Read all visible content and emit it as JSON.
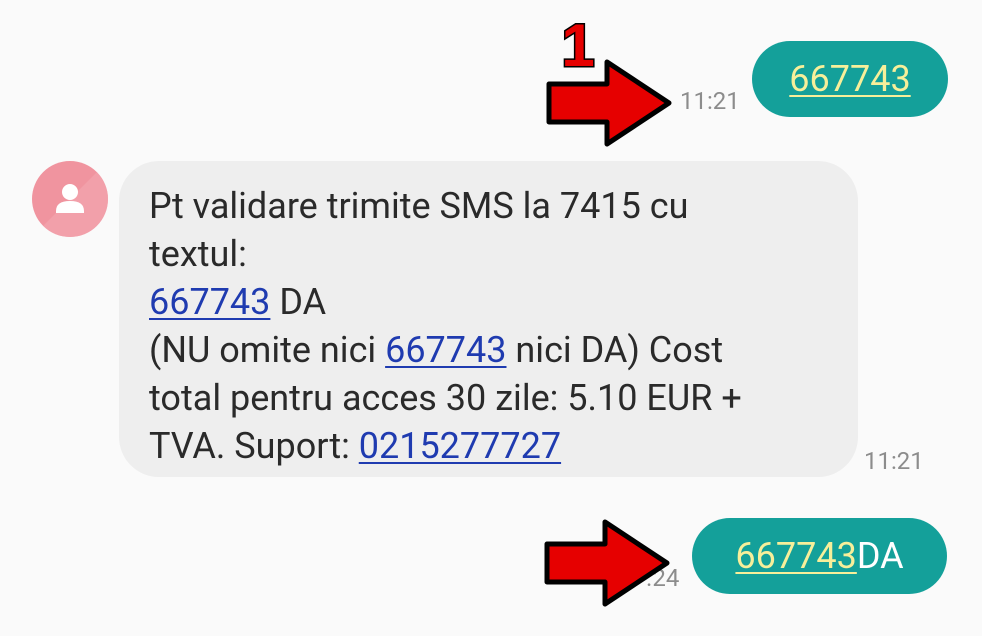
{
  "thread": {
    "messages": [
      {
        "direction": "outgoing",
        "link_text": "667743",
        "text": "",
        "time": "11:21"
      },
      {
        "direction": "incoming",
        "sender_avatar_icon": "person-icon",
        "lines": [
          {
            "before": "Pt validare trimite SMS la 7415 cu",
            "link": "",
            "after": ""
          },
          {
            "before": "textul:",
            "link": "",
            "after": ""
          },
          {
            "before": "",
            "link": "667743",
            "after": " DA"
          },
          {
            "before": "(NU omite nici ",
            "link": "667743",
            "after": " nici DA) Cost"
          },
          {
            "before": "total pentru acces 30 zile: 5.10 EUR +",
            "link": "",
            "after": ""
          },
          {
            "before": "TVA. Suport: ",
            "link": "0215277727",
            "after": ""
          }
        ],
        "time": "11:21"
      },
      {
        "direction": "outgoing",
        "link_text": "667743",
        "text": " DA",
        "time": ".24"
      }
    ]
  },
  "annotations": {
    "step_number": "1",
    "arrow_color": "#e60000",
    "arrow_outline": "#000000"
  },
  "colors": {
    "outgoing_bubble": "#14a09a",
    "outgoing_link": "#f7ef9a",
    "incoming_bubble": "#eeeeee",
    "incoming_link": "#1f3bb0",
    "avatar": "#f0949f",
    "background": "#fafafa"
  }
}
